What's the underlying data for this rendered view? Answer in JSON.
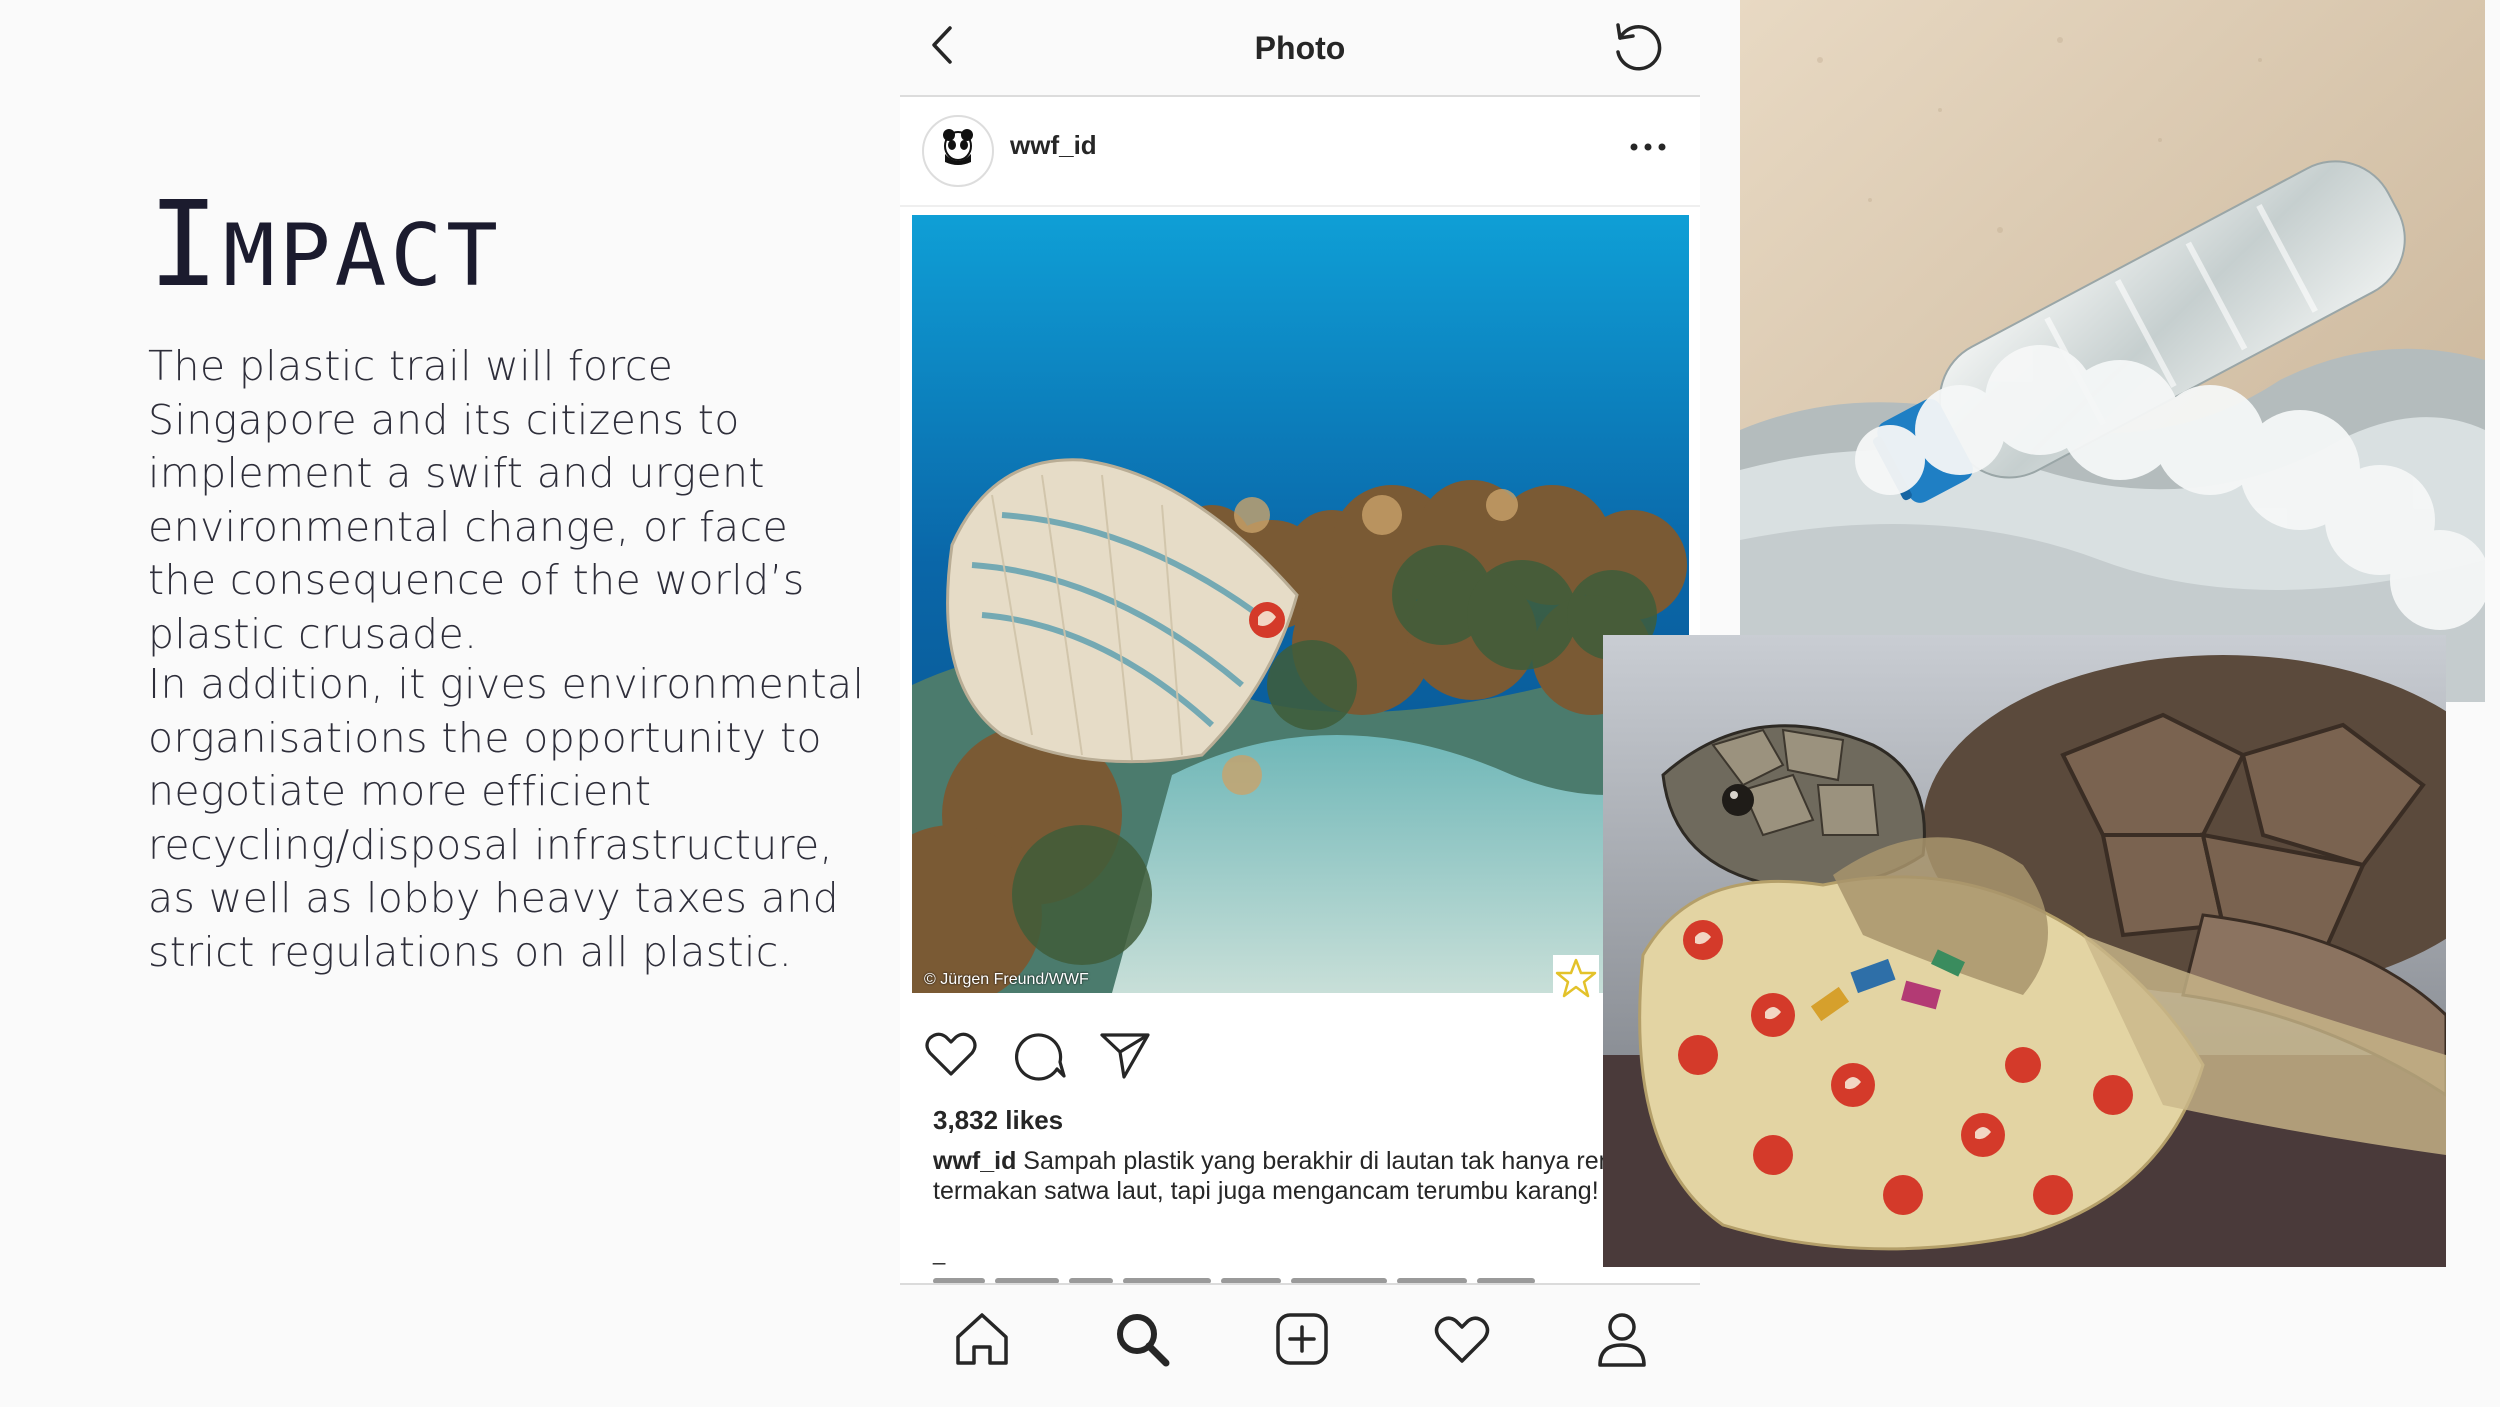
{
  "slide": {
    "title_cap": "I",
    "title_rest": "MPACT",
    "paragraph1": "The plastic trail will force Singapore and its citizens to implement a swift and urgent environmental change, or face the consequence of the world’s plastic crusade.",
    "paragraph2": "In addition, it gives environmental organisations the opportunity to negotiate more efficient recycling/disposal infrastructure, as well as lobby heavy taxes and strict regulations on all plastic."
  },
  "instagram": {
    "header_title": "Photo",
    "username": "wwf_id",
    "avatar_text": "WWF",
    "photo_credit": "© Jürgen Freund/WWF",
    "likes": "3,832 likes",
    "caption_user": "wwf_id",
    "caption_text": " Sampah plastik yang berakhir di lautan tak hanya rentan termakan satwa laut, tapi juga mengancam terumbu karang!",
    "caption_dash": "_",
    "icons": {
      "back": "back-chevron-icon",
      "refresh": "refresh-icon",
      "more": "more-options-icon",
      "like": "heart-icon",
      "comment": "comment-icon",
      "share": "send-icon",
      "home": "home-icon",
      "search": "search-icon",
      "add": "add-post-icon",
      "activity": "activity-heart-icon",
      "profile": "profile-icon"
    }
  },
  "colors": {
    "title": "#1b1b2e",
    "body_text": "#2e2e3a",
    "ig_text": "#262626",
    "ocean": "#0b76b0",
    "bottle_cap": "#1f7fc4",
    "bag_logo_red": "#d43a2a"
  }
}
